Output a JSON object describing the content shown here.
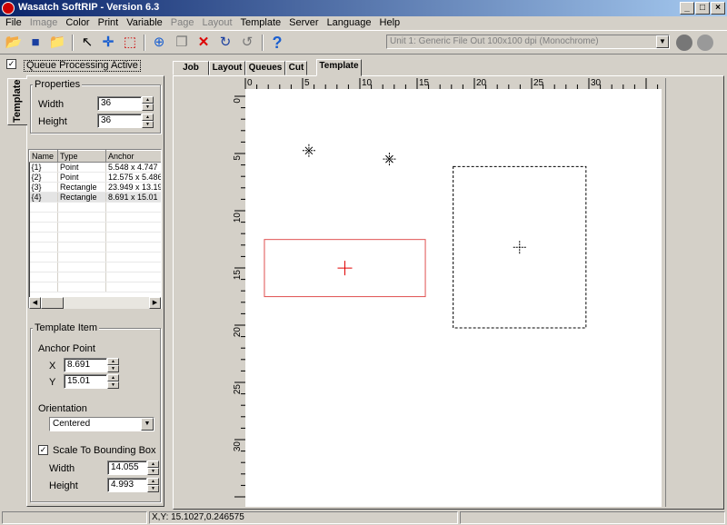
{
  "window": {
    "title": "Wasatch SoftRIP - Version 6.3",
    "buttons": [
      "_",
      "□",
      "×"
    ]
  },
  "menu": [
    {
      "label": "File",
      "enabled": true
    },
    {
      "label": "Image",
      "enabled": false
    },
    {
      "label": "Color",
      "enabled": true
    },
    {
      "label": "Print",
      "enabled": true
    },
    {
      "label": "Variable",
      "enabled": true
    },
    {
      "label": "Page",
      "enabled": false
    },
    {
      "label": "Layout",
      "enabled": false
    },
    {
      "label": "Template",
      "enabled": true
    },
    {
      "label": "Server",
      "enabled": true
    },
    {
      "label": "Language",
      "enabled": true
    },
    {
      "label": "Help",
      "enabled": true
    }
  ],
  "toolbar": {
    "icons": [
      "open-folder-icon",
      "save-icon",
      "open-template-icon",
      "pointer-icon",
      "add-point-icon",
      "add-rectangle-icon",
      "fit-icon",
      "copy-icon",
      "delete-icon",
      "redo-icon",
      "undo-icon",
      "help-icon"
    ],
    "unit_select": "Unit 1: Generic  File Out 100x100 dpi (Monochrome)"
  },
  "queue": {
    "label": "Queue Processing Active",
    "checked": "✓"
  },
  "side_tab": "Template",
  "properties": {
    "title": "Properties",
    "width_label": "Width",
    "width_value": "36",
    "height_label": "Height",
    "height_value": "36"
  },
  "list": {
    "columns": [
      "Name",
      "Type",
      "Anchor"
    ],
    "rows": [
      {
        "name": "{1}",
        "type": "Point",
        "anchor": "5.548 x 4.747"
      },
      {
        "name": "{2}",
        "type": "Point",
        "anchor": "12.575 x 5.486"
      },
      {
        "name": "{3}",
        "type": "Rectangle",
        "anchor": "23.949 x 13.19"
      },
      {
        "name": "{4}",
        "type": "Rectangle",
        "anchor": "8.691 x 15.01"
      }
    ]
  },
  "template_item": {
    "title": "Template Item",
    "anchor_label": "Anchor Point",
    "x_label": "X",
    "x_value": "8.691",
    "y_label": "Y",
    "y_value": "15.01",
    "orientation_label": "Orientation",
    "orientation_value": "Centered",
    "scale_label": "Scale To Bounding Box",
    "scale_checked": "✓",
    "width_label": "Width",
    "width_value": "14.055",
    "height_label": "Height",
    "height_value": "4.993"
  },
  "tabs": [
    "Job",
    "Layout",
    "Queues",
    "Cut",
    "Template"
  ],
  "ruler": {
    "top_labels": [
      "0",
      "5",
      "10",
      "15",
      "20",
      "25",
      "30"
    ],
    "left_labels": [
      "0",
      "5",
      "10",
      "15",
      "20",
      "25",
      "30"
    ]
  },
  "canvas_items": [
    {
      "name": "{1}",
      "type": "point",
      "x": 5.548,
      "y": 4.747
    },
    {
      "name": "{2}",
      "type": "point",
      "x": 12.575,
      "y": 5.486
    },
    {
      "name": "{3}",
      "type": "rectangle",
      "x": 23.949,
      "y": 13.19,
      "w": 11.6,
      "h": 14.1,
      "style": "dashed"
    },
    {
      "name": "{4}",
      "type": "rectangle",
      "x": 8.691,
      "y": 15.01,
      "w": 14.055,
      "h": 4.993,
      "style": "selected"
    }
  ],
  "status": {
    "coords": "X,Y: 15.1027,0.246575"
  }
}
